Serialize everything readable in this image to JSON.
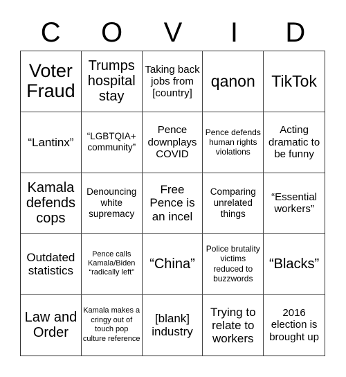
{
  "header": [
    "C",
    "O",
    "V",
    "I",
    "D"
  ],
  "cells": [
    "Voter Fraud",
    "Trumps hospital stay",
    "Taking back jobs from [country]",
    "qanon",
    "TikTok",
    "“Lantinx”",
    "“LGBTQIA+ community”",
    "Pence downplays COVID",
    "Pence defends human rights violations",
    "Acting dramatic to be funny",
    "Kamala defends cops",
    "Denouncing white supremacy",
    "Free Pence is an incel",
    "Comparing unrelated things",
    "“Essential workers”",
    "Outdated statistics",
    "Pence calls Kamala/Biden “radically left”",
    "“China”",
    "Police brutality victims reduced to buzzwords",
    "“Blacks”",
    "Law and Order",
    "Kamala makes a cringy out of touch pop culture reference",
    "[blank] industry",
    "Trying to relate to workers",
    "2016 election is brought up"
  ]
}
